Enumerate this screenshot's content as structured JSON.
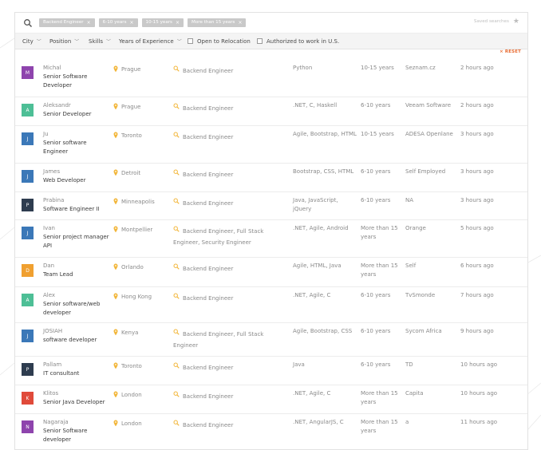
{
  "search": {
    "chips": [
      "Backend Engineer",
      "6-10 years",
      "10-15 years",
      "More than 15 years"
    ],
    "saved_label": "Saved searches"
  },
  "filters": {
    "city": "City",
    "position": "Position",
    "skills": "Skills",
    "experience": "Years of Experience",
    "relocation": "Open to Relocation",
    "authorized": "Authorized to work in U.S.",
    "reset": "RESET"
  },
  "colors": {
    "accent": "#e8692e",
    "pin": "#f2b63a",
    "avatar_purple": "#8e44ad",
    "avatar_green": "#4dbf96",
    "avatar_blue": "#3b78b8",
    "avatar_navy": "#2e3c4f",
    "avatar_orange": "#f0a030",
    "avatar_red": "#e04a3a"
  },
  "candidates": [
    {
      "initial": "M",
      "color": "#8e44ad",
      "name": "Michal",
      "title": "Senior Software Developer",
      "city": "Prague",
      "position": "Backend Engineer",
      "skills": "Python",
      "years": "10-15 years",
      "company": "Seznam.cz",
      "time": "2 hours ago"
    },
    {
      "initial": "A",
      "color": "#4dbf96",
      "name": "Aleksandr",
      "title": "Senior Developer",
      "city": "Prague",
      "position": "Backend Engineer",
      "skills": ".NET, C, Haskell",
      "years": "6-10 years",
      "company": "Veeam Software",
      "time": "2 hours ago"
    },
    {
      "initial": "J",
      "color": "#3b78b8",
      "name": "Ju",
      "title": "Senior software Engineer",
      "city": "Toronto",
      "position": "Backend Engineer",
      "skills": "Agile, Bootstrap, HTML",
      "years": "10-15 years",
      "company": "ADESA Openlane",
      "time": "3 hours ago"
    },
    {
      "initial": "J",
      "color": "#3b78b8",
      "name": "James",
      "title": "Web Developer",
      "city": "Detroit",
      "position": "Backend Engineer",
      "skills": "Bootstrap, CSS, HTML",
      "years": "6-10 years",
      "company": "Self Employed",
      "time": "3 hours ago"
    },
    {
      "initial": "P",
      "color": "#2e3c4f",
      "name": "Prabina",
      "title": "Software Engineer II",
      "city": "Minneapolis",
      "position": "Backend Engineer",
      "skills": "Java, JavaScript, jQuery",
      "years": "6-10 years",
      "company": "NA",
      "time": "3 hours ago"
    },
    {
      "initial": "J",
      "color": "#3b78b8",
      "name": "Ivan",
      "title": "Senior project manager API",
      "city": "Montpellier",
      "position": "Backend Engineer, Full Stack Engineer, Security Engineer",
      "skills": ".NET, Agile, Android",
      "years": "More than 15 years",
      "company": "Orange",
      "time": "5 hours ago"
    },
    {
      "initial": "D",
      "color": "#f0a030",
      "name": "Dan",
      "title": "Team Lead",
      "city": "Orlando",
      "position": "Backend Engineer",
      "skills": "Agile, HTML, Java",
      "years": "More than 15 years",
      "company": "Self",
      "time": "6 hours ago"
    },
    {
      "initial": "A",
      "color": "#4dbf96",
      "name": "Alex",
      "title": "Senior software/web developer",
      "city": "Hong Kong",
      "position": "Backend Engineer",
      "skills": ".NET, Agile, C",
      "years": "6-10 years",
      "company": "TvSmonde",
      "time": "7 hours ago"
    },
    {
      "initial": "J",
      "color": "#3b78b8",
      "name": "JOSIAH",
      "title": "software developer",
      "city": "Kenya",
      "position": "Backend Engineer, Full Stack Engineer",
      "skills": "Agile, Bootstrap, CSS",
      "years": "6-10 years",
      "company": "Sycom Africa",
      "time": "9 hours ago"
    },
    {
      "initial": "P",
      "color": "#2e3c4f",
      "name": "Pallam",
      "title": "IT consultant",
      "city": "Toronto",
      "position": "Backend Engineer",
      "skills": "Java",
      "years": "6-10 years",
      "company": "TD",
      "time": "10 hours ago"
    },
    {
      "initial": "K",
      "color": "#e04a3a",
      "name": "Klitos",
      "title": "Senior Java Developer",
      "city": "London",
      "position": "Backend Engineer",
      "skills": ".NET, Agile, C",
      "years": "More than 15 years",
      "company": "Capita",
      "time": "10 hours ago"
    },
    {
      "initial": "N",
      "color": "#8e44ad",
      "name": "Nagaraja",
      "title": "Senior Software developer",
      "city": "London",
      "position": "Backend Engineer",
      "skills": ".NET, AngularJS, C",
      "years": "More than 15 years",
      "company": "a",
      "time": "11 hours ago"
    }
  ]
}
